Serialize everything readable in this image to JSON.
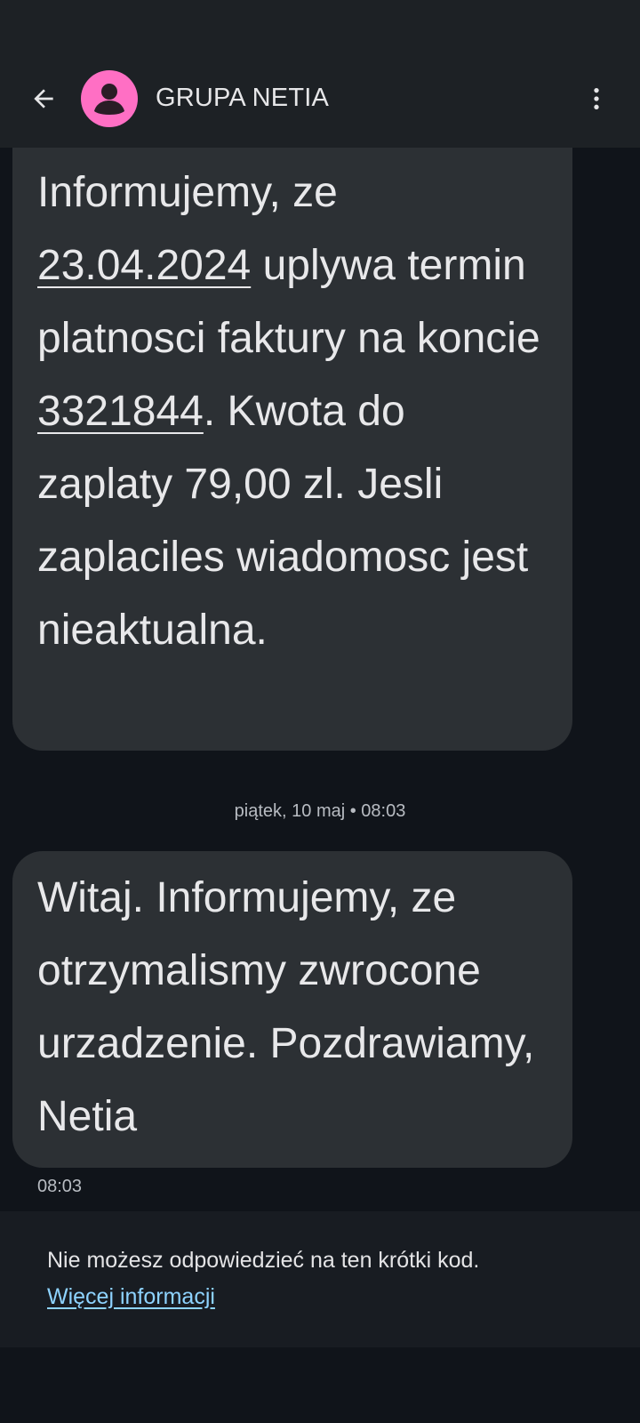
{
  "header": {
    "contact_name": "GRUPA NETIA",
    "avatar_color": "#ff6fc4",
    "back_icon": "arrow-left-icon",
    "more_icon": "more-vert-icon"
  },
  "messages": [
    {
      "parts": [
        {
          "text": "Informujemy, ze ",
          "link": false
        },
        {
          "text": "23.04.2024",
          "link": true
        },
        {
          "text": " uplywa termin platnosci faktury na koncie ",
          "link": false
        },
        {
          "text": "3321844",
          "link": true
        },
        {
          "text": ". Kwota do zaplaty 79,00 zl. Jesli zaplaciles wiadomosc jest nieaktualna.",
          "link": false
        }
      ]
    },
    {
      "parts": [
        {
          "text": "Witaj. Informujemy, ze otrzymalismy zwrocone urzadzenie. Pozdrawiamy, Netia",
          "link": false
        }
      ]
    }
  ],
  "date_separator": "piątek, 10 maj • 08:03",
  "last_message_time": "08:03",
  "footer": {
    "info_text": "Nie możesz odpowiedzieć na ten krótki kod.",
    "more_info_link": "Więcej informacji"
  },
  "colors": {
    "background": "#10141a",
    "bar": "#1d2125",
    "bubble": "#2c3034",
    "link": "#8ed3ff"
  }
}
